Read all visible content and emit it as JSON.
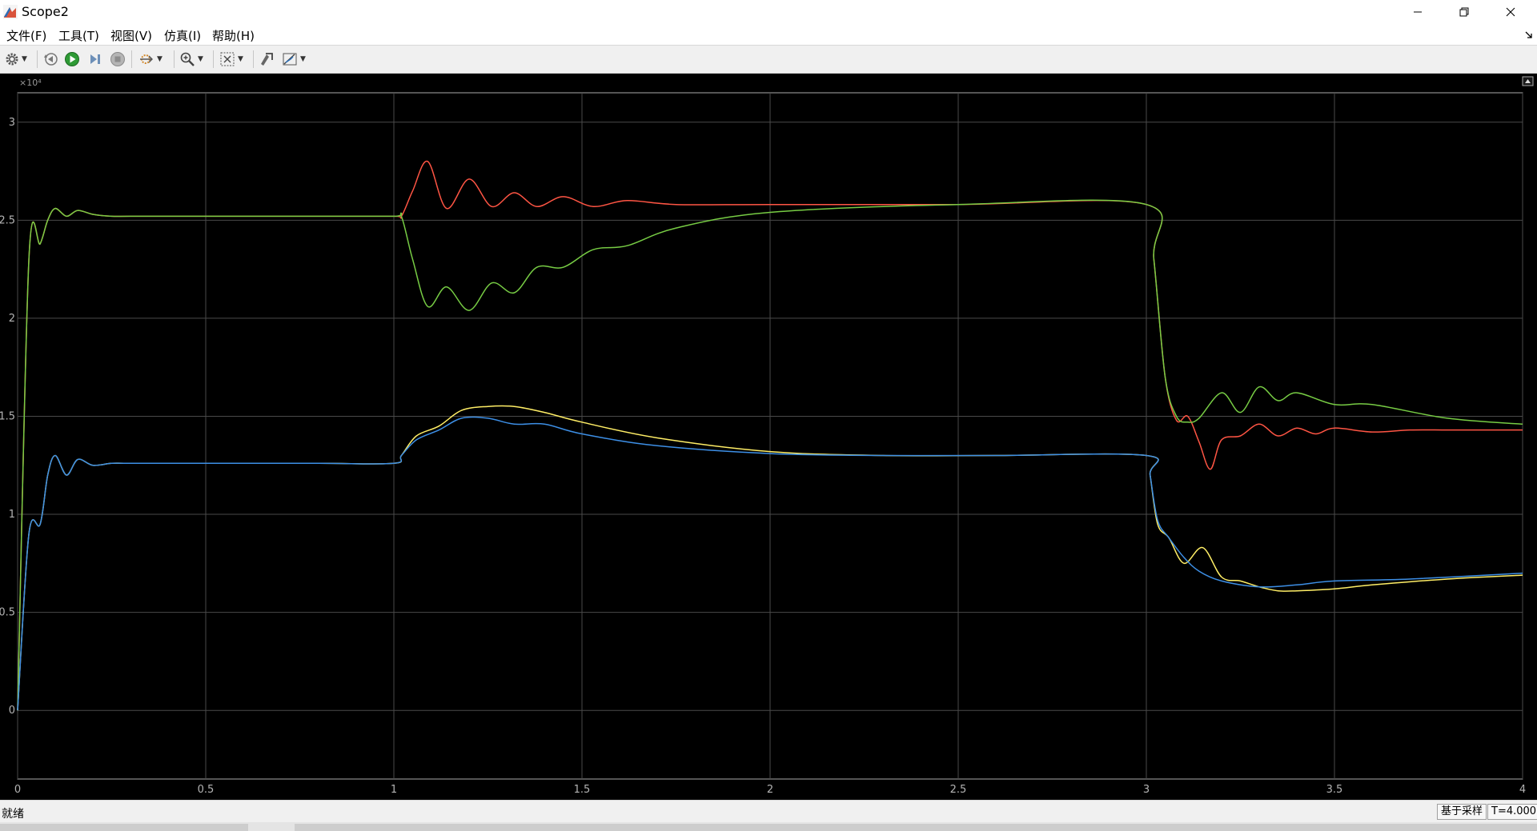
{
  "window": {
    "title": "Scope2"
  },
  "menu": [
    {
      "label": "文件(F)"
    },
    {
      "label": "工具(T)"
    },
    {
      "label": "视图(V)"
    },
    {
      "label": "仿真(I)"
    },
    {
      "label": "帮助(H)"
    }
  ],
  "toolbar": {
    "icons": [
      "gear-icon",
      "rewind-icon",
      "run-icon",
      "step-forward-icon",
      "stop-icon",
      "signal-selector-icon",
      "zoom-icon",
      "autoscale-icon",
      "highlight-icon",
      "cursor-measure-icon"
    ]
  },
  "status": {
    "ready": "就绪",
    "sample_mode": "基于采样",
    "time": "T=4.000"
  },
  "chart_data": {
    "type": "line",
    "y_exponent": "×10⁴",
    "xlim": [
      0,
      4
    ],
    "ylim": [
      -0.35,
      3.15
    ],
    "x_ticks": [
      "0",
      "0.5",
      "1",
      "1.5",
      "2",
      "2.5",
      "3",
      "3.5",
      "4"
    ],
    "y_ticks": [
      "0",
      "0.5",
      "1",
      "1.5",
      "2",
      "2.5",
      "3"
    ],
    "x_tick_values": [
      0,
      0.5,
      1,
      1.5,
      2,
      2.5,
      3,
      3.5,
      4
    ],
    "y_tick_values": [
      0,
      0.5,
      1,
      1.5,
      2,
      2.5,
      3
    ],
    "grid": true,
    "series": [
      {
        "color": "#ff5544",
        "x": [
          0,
          0.03,
          0.06,
          0.08,
          0.1,
          0.13,
          0.16,
          0.2,
          0.25,
          0.3,
          0.5,
          0.8,
          1.0,
          1.02,
          1.05,
          1.09,
          1.14,
          1.2,
          1.26,
          1.32,
          1.38,
          1.45,
          1.53,
          1.62,
          1.75,
          2.0,
          2.5,
          3.0,
          3.02,
          3.05,
          3.08,
          3.11,
          3.14,
          3.17,
          3.2,
          3.25,
          3.3,
          3.35,
          3.4,
          3.45,
          3.5,
          3.6,
          3.7,
          3.8,
          3.9,
          4.0
        ],
        "y": [
          0,
          2.3,
          2.38,
          2.5,
          2.56,
          2.52,
          2.55,
          2.53,
          2.52,
          2.52,
          2.52,
          2.52,
          2.52,
          2.52,
          2.65,
          2.8,
          2.56,
          2.71,
          2.57,
          2.64,
          2.57,
          2.62,
          2.57,
          2.6,
          2.58,
          2.58,
          2.58,
          2.58,
          2.3,
          1.7,
          1.48,
          1.5,
          1.37,
          1.23,
          1.38,
          1.4,
          1.46,
          1.4,
          1.44,
          1.41,
          1.44,
          1.42,
          1.43,
          1.43,
          1.43,
          1.43
        ]
      },
      {
        "color": "#77cc44",
        "x": [
          0,
          0.03,
          0.06,
          0.08,
          0.1,
          0.13,
          0.16,
          0.2,
          0.25,
          0.3,
          0.5,
          0.8,
          1.0,
          1.02,
          1.05,
          1.09,
          1.14,
          1.2,
          1.26,
          1.32,
          1.38,
          1.45,
          1.53,
          1.62,
          1.75,
          2.0,
          2.5,
          3.0,
          3.02,
          3.05,
          3.08,
          3.11,
          3.14,
          3.2,
          3.25,
          3.3,
          3.35,
          3.4,
          3.5,
          3.6,
          3.8,
          4.0
        ],
        "y": [
          0,
          2.3,
          2.38,
          2.5,
          2.56,
          2.52,
          2.55,
          2.53,
          2.52,
          2.52,
          2.52,
          2.52,
          2.52,
          2.52,
          2.3,
          2.06,
          2.16,
          2.04,
          2.18,
          2.13,
          2.26,
          2.26,
          2.35,
          2.37,
          2.46,
          2.54,
          2.58,
          2.58,
          2.3,
          1.7,
          1.5,
          1.47,
          1.49,
          1.62,
          1.52,
          1.65,
          1.58,
          1.62,
          1.56,
          1.56,
          1.49,
          1.46
        ]
      },
      {
        "color": "#ffee66",
        "x": [
          0,
          0.03,
          0.06,
          0.08,
          0.1,
          0.13,
          0.16,
          0.2,
          0.25,
          0.3,
          0.5,
          0.8,
          1.0,
          1.02,
          1.06,
          1.12,
          1.18,
          1.25,
          1.32,
          1.4,
          1.5,
          1.7,
          2.0,
          2.3,
          2.6,
          3.0,
          3.01,
          3.03,
          3.06,
          3.1,
          3.15,
          3.2,
          3.25,
          3.3,
          3.35,
          3.4,
          3.5,
          3.6,
          3.8,
          4.0
        ],
        "y": [
          0,
          0.9,
          0.95,
          1.2,
          1.3,
          1.2,
          1.28,
          1.25,
          1.26,
          1.26,
          1.26,
          1.26,
          1.26,
          1.3,
          1.4,
          1.45,
          1.53,
          1.55,
          1.55,
          1.52,
          1.47,
          1.39,
          1.32,
          1.3,
          1.3,
          1.3,
          1.2,
          0.95,
          0.88,
          0.75,
          0.83,
          0.68,
          0.66,
          0.63,
          0.61,
          0.61,
          0.62,
          0.64,
          0.67,
          0.69
        ]
      },
      {
        "color": "#3d8fe6",
        "x": [
          0,
          0.03,
          0.06,
          0.08,
          0.1,
          0.13,
          0.16,
          0.2,
          0.25,
          0.3,
          0.5,
          0.8,
          1.0,
          1.02,
          1.06,
          1.12,
          1.18,
          1.25,
          1.32,
          1.4,
          1.5,
          1.7,
          2.0,
          2.3,
          2.6,
          3.0,
          3.01,
          3.03,
          3.06,
          3.1,
          3.14,
          3.2,
          3.3,
          3.4,
          3.5,
          3.7,
          4.0
        ],
        "y": [
          0,
          0.9,
          0.95,
          1.2,
          1.3,
          1.2,
          1.28,
          1.25,
          1.26,
          1.26,
          1.26,
          1.26,
          1.26,
          1.3,
          1.38,
          1.43,
          1.49,
          1.49,
          1.46,
          1.46,
          1.41,
          1.35,
          1.31,
          1.3,
          1.3,
          1.3,
          1.2,
          0.97,
          0.88,
          0.78,
          0.71,
          0.66,
          0.63,
          0.64,
          0.66,
          0.67,
          0.7
        ]
      }
    ]
  }
}
